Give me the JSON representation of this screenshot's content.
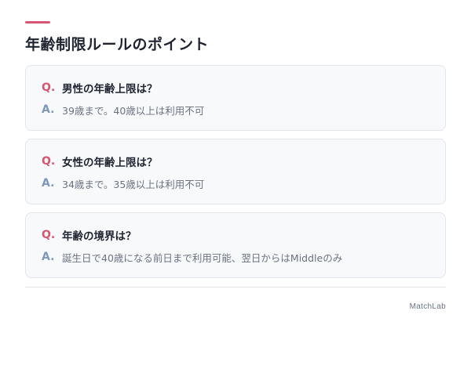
{
  "page": {
    "title": "年齢制限ルールのポイント",
    "accent_color": "#d9546e",
    "question_mark": "Q.",
    "answer_mark": "A."
  },
  "faq": [
    {
      "question": "男性の年齢上限は？",
      "answer": "39歳まで。40歳以上は利用不可"
    },
    {
      "question": "女性の年齢上限は？",
      "answer": "34歳まで。35歳以上は利用不可"
    },
    {
      "question": "年齢の境界は？",
      "answer": "誕生日で40歳になる前日まで利用可能、翌日からはMiddleのみ"
    }
  ],
  "footer": {
    "brand": "MatchLab"
  }
}
